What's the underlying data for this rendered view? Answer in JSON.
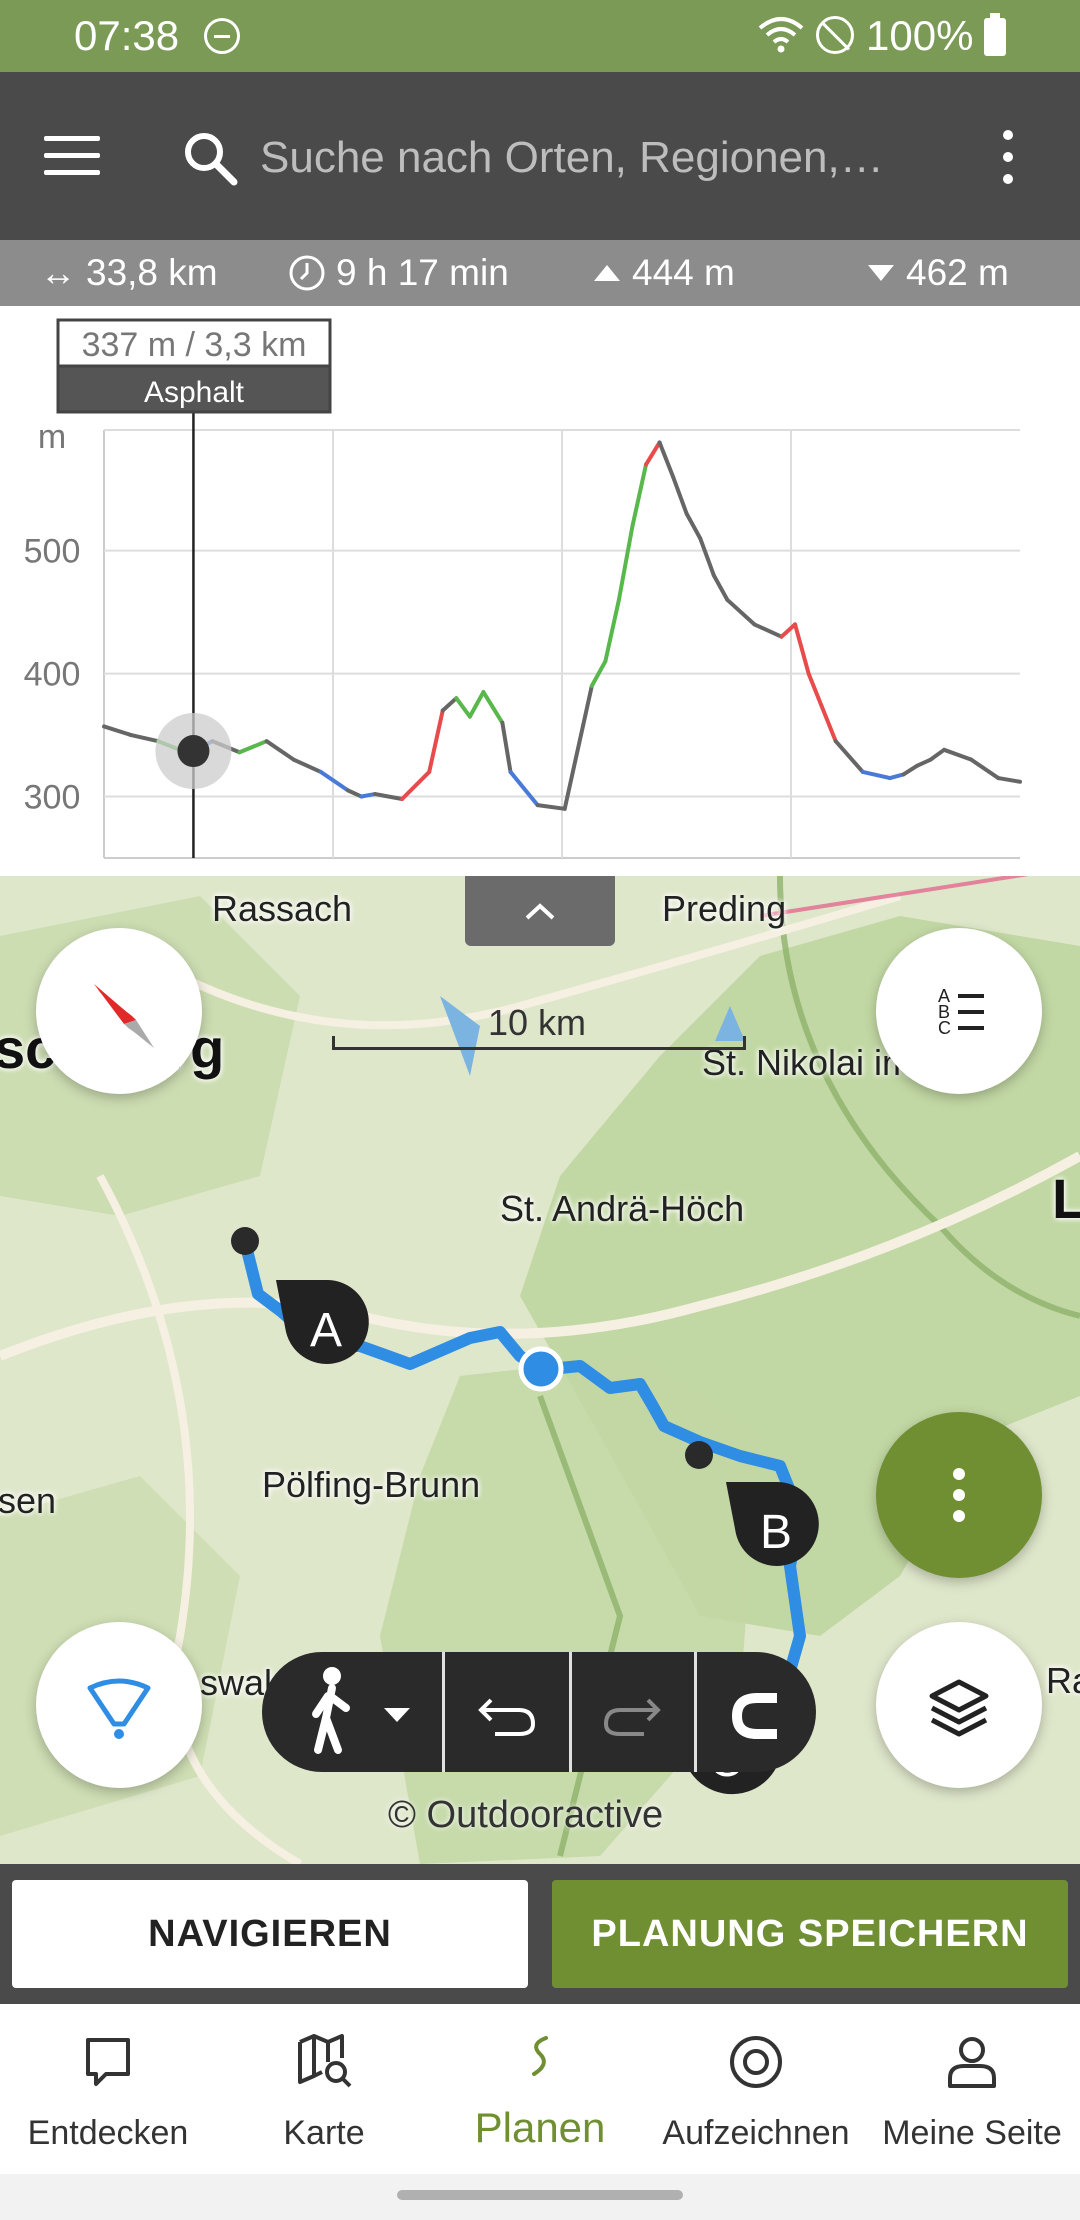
{
  "status_bar": {
    "time": "07:38",
    "battery": "100%"
  },
  "search": {
    "placeholder": "Suche nach Orten, Regionen,…"
  },
  "stats": {
    "distance": "33,8 km",
    "duration": "9 h 17 min",
    "ascent": "444 m",
    "descent": "462 m"
  },
  "chart_data": {
    "type": "line",
    "ylabel": "m",
    "y_ticks": [
      "500",
      "400",
      "300"
    ],
    "ylim": [
      250,
      590
    ],
    "xlim": [
      0,
      33.8
    ],
    "grid": true,
    "x": [
      0,
      1,
      2,
      2.8,
      3.3,
      4,
      5,
      6,
      7,
      8,
      9,
      9.5,
      10,
      11,
      12,
      12.5,
      13,
      13.5,
      14,
      14.7,
      15,
      16,
      17,
      18,
      18.5,
      19,
      19.5,
      20,
      20.5,
      21,
      21.5,
      22,
      22.5,
      23,
      24,
      25,
      25.5,
      26,
      27,
      28,
      29,
      29.5,
      30,
      30.5,
      31,
      32,
      33,
      33.8
    ],
    "values": [
      357,
      350,
      345,
      338,
      337,
      345,
      336,
      345,
      330,
      320,
      305,
      300,
      302,
      298,
      320,
      370,
      380,
      365,
      385,
      360,
      320,
      293,
      290,
      390,
      410,
      460,
      520,
      570,
      588,
      560,
      530,
      510,
      480,
      460,
      440,
      430,
      440,
      400,
      345,
      320,
      315,
      318,
      325,
      330,
      338,
      330,
      315,
      312
    ],
    "marker": {
      "x": 3.3,
      "y": 337
    },
    "tooltip": {
      "value": "337 m / 3,3 km",
      "surface": "Asphalt"
    },
    "surface_legend": {
      "grey": "#666666",
      "red": "#e84b4b",
      "green": "#58b84b",
      "blue": "#4a7ad8"
    }
  },
  "map": {
    "places": {
      "rassach": "Rassach",
      "preding": "Preding",
      "deutschlandsberg": "sc    sberg",
      "st_nikolai": "St. Nikolai im S",
      "st_andrae": "St. Andrä-Höch",
      "poelfing": "Pölfing-Brunn",
      "sen": "sen",
      "swald": "swald",
      "ra": "Ra",
      "l": "L"
    },
    "scale": "10 km",
    "waypoints": {
      "a": "A",
      "b": "B",
      "c": "C"
    },
    "copyright": "© Outdooractive",
    "colors": {
      "route": "#2f8de4",
      "accent": "#6f8f32"
    }
  },
  "actions": {
    "navigate": "NAVIGIEREN",
    "save": "PLANUNG SPEICHERN"
  },
  "bottom_nav": {
    "items": [
      {
        "label": "Entdecken",
        "icon": "chat-bubble-icon"
      },
      {
        "label": "Karte",
        "icon": "map-search-icon"
      },
      {
        "label": "Planen",
        "icon": "route-icon"
      },
      {
        "label": "Aufzeichnen",
        "icon": "record-icon"
      },
      {
        "label": "Meine Seite",
        "icon": "user-icon"
      }
    ],
    "active": "Planen"
  }
}
